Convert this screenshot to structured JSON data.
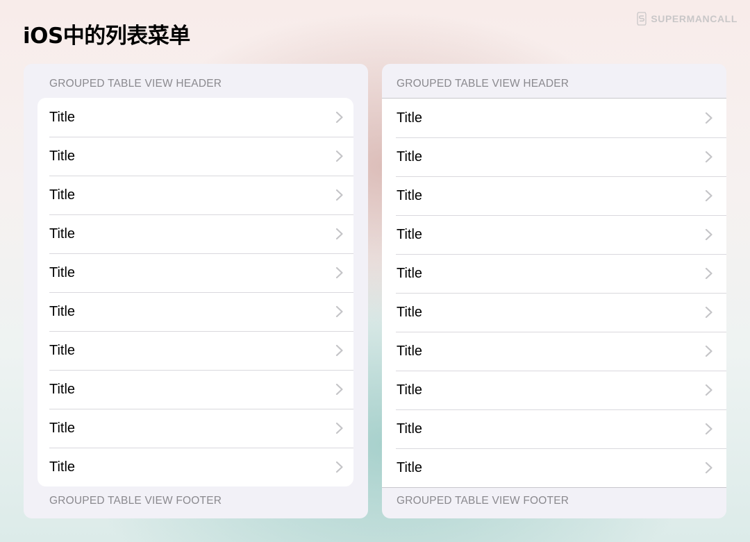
{
  "page": {
    "title": "iOS中的列表菜单",
    "brand": "SUPERMANCALL"
  },
  "panels": [
    {
      "style": "inset-grouped",
      "header": "GROUPED TABLE VIEW HEADER",
      "footer": "GROUPED TABLE VIEW FOOTER",
      "rows": [
        {
          "title": "Title",
          "accessory": "chevron-right-icon"
        },
        {
          "title": "Title",
          "accessory": "chevron-right-icon"
        },
        {
          "title": "Title",
          "accessory": "chevron-right-icon"
        },
        {
          "title": "Title",
          "accessory": "chevron-right-icon"
        },
        {
          "title": "Title",
          "accessory": "chevron-right-icon"
        },
        {
          "title": "Title",
          "accessory": "chevron-right-icon"
        },
        {
          "title": "Title",
          "accessory": "chevron-right-icon"
        },
        {
          "title": "Title",
          "accessory": "chevron-right-icon"
        },
        {
          "title": "Title",
          "accessory": "chevron-right-icon"
        },
        {
          "title": "Title",
          "accessory": "chevron-right-icon"
        }
      ]
    },
    {
      "style": "grouped",
      "header": "GROUPED TABLE VIEW HEADER",
      "footer": "GROUPED TABLE VIEW FOOTER",
      "rows": [
        {
          "title": "Title",
          "accessory": "chevron-right-icon"
        },
        {
          "title": "Title",
          "accessory": "chevron-right-icon"
        },
        {
          "title": "Title",
          "accessory": "chevron-right-icon"
        },
        {
          "title": "Title",
          "accessory": "chevron-right-icon"
        },
        {
          "title": "Title",
          "accessory": "chevron-right-icon"
        },
        {
          "title": "Title",
          "accessory": "chevron-right-icon"
        },
        {
          "title": "Title",
          "accessory": "chevron-right-icon"
        },
        {
          "title": "Title",
          "accessory": "chevron-right-icon"
        },
        {
          "title": "Title",
          "accessory": "chevron-right-icon"
        },
        {
          "title": "Title",
          "accessory": "chevron-right-icon"
        }
      ]
    }
  ],
  "colors": {
    "panel_bg": "#f2f1f7",
    "cell_bg": "#ffffff",
    "secondary_text": "#8a898e",
    "separator": "#d9d8dd",
    "chevron": "#c4c4c7"
  }
}
